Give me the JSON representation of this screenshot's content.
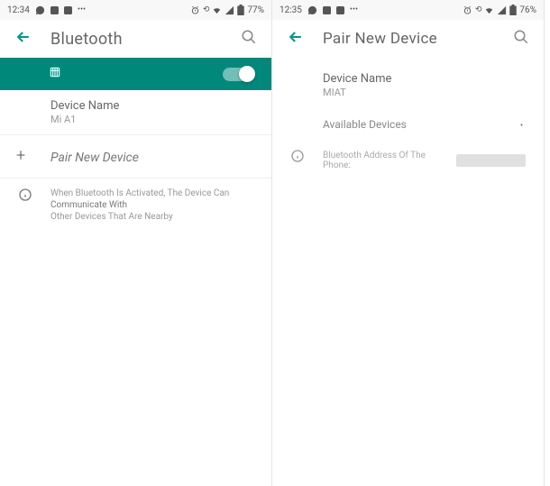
{
  "screens": {
    "left": {
      "status": {
        "time": "12:34",
        "battery": "77%"
      },
      "title": "Bluetooth",
      "device_label": "Device Name",
      "device_value": "Mi A1",
      "pair_label": "Pair New Device",
      "info_text_1": "When Bluetooth Is Activated, The Device Can",
      "info_text_2": "Communicate With",
      "info_text_3": "Other Devices That Are Nearby"
    },
    "right": {
      "status": {
        "time": "12:35",
        "battery": "76%"
      },
      "title": "Pair New Device",
      "device_label": "Device Name",
      "device_value": "MIAT",
      "available_label": "Available Devices",
      "addr_label": "Bluetooth Address Of The Phone:"
    }
  }
}
